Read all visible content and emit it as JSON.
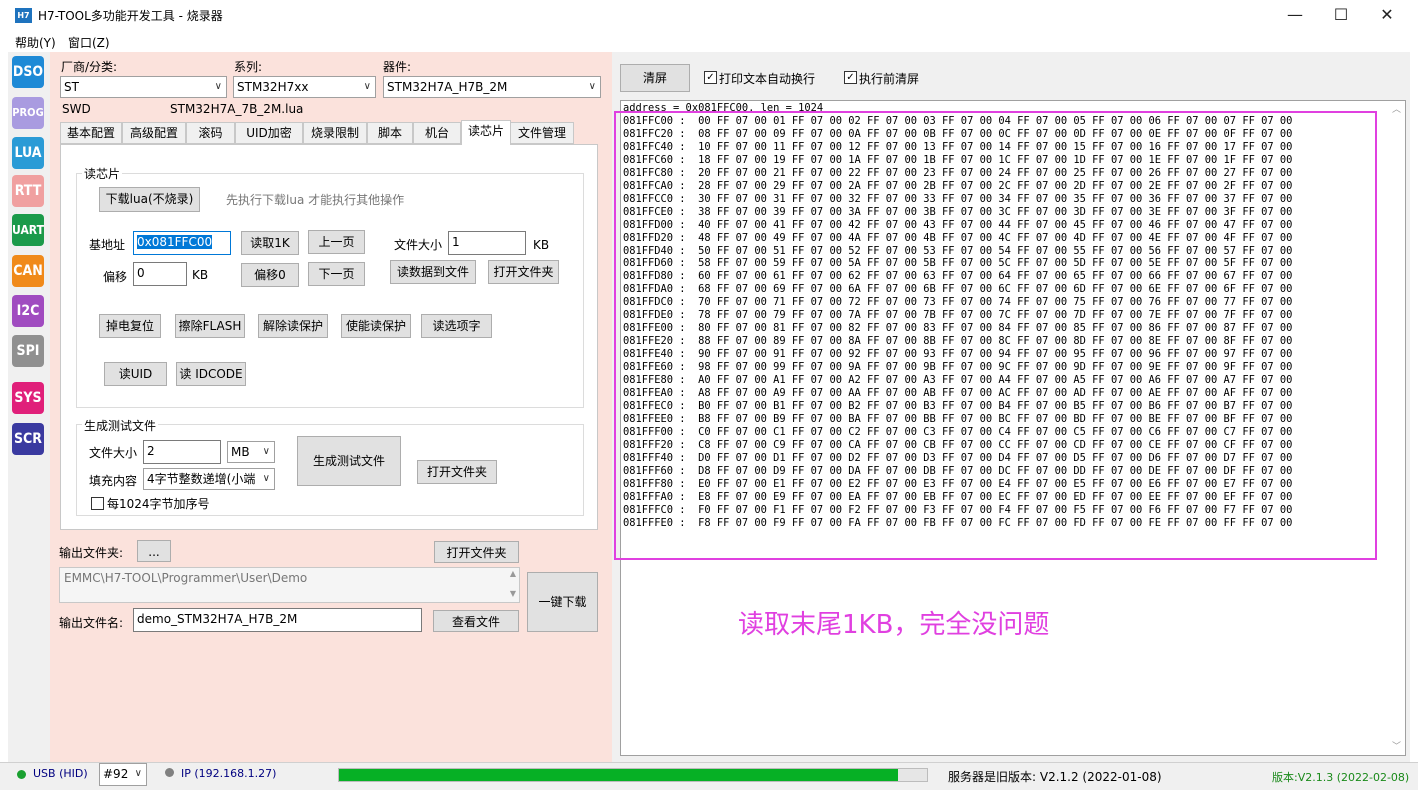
{
  "window": {
    "icon_text": "H7",
    "title": "H7-TOOL多功能开发工具 - 烧录器",
    "minimize": "—",
    "maximize": "☐",
    "close": "✕"
  },
  "menu": {
    "help": "帮助(Y)",
    "window": "窗口(Z)"
  },
  "sidebar": {
    "items": [
      {
        "label": "DSO",
        "color": "#1e8ad6"
      },
      {
        "label": "PROG",
        "color": "#a99be0"
      },
      {
        "label": "LUA",
        "color": "#2a9bd6"
      },
      {
        "label": "RTT",
        "color": "#f0a0a0"
      },
      {
        "label": "UART",
        "color": "#1a9a4a"
      },
      {
        "label": "CAN",
        "color": "#f08a1a"
      },
      {
        "label": "I2C",
        "color": "#a04cc0"
      },
      {
        "label": "SPI",
        "color": "#909090"
      },
      {
        "label": "SYS",
        "color": "#e0207a"
      },
      {
        "label": "SCR",
        "color": "#3a3aa0"
      }
    ]
  },
  "selectors": {
    "vendor_label": "厂商/分类:",
    "vendor_value": "ST",
    "series_label": "系列:",
    "series_value": "STM32H7xx",
    "device_label": "器件:",
    "device_value": "STM32H7A_H7B_2M",
    "interface": "SWD",
    "lua_file": "STM32H7A_7B_2M.lua"
  },
  "tabs": [
    "基本配置",
    "高级配置",
    "滚码",
    "UID加密",
    "烧录限制",
    "脚本",
    "机台",
    "读芯片",
    "文件管理"
  ],
  "active_tab": "读芯片",
  "read_chip": {
    "group_title": "读芯片",
    "download_lua_button": "下载lua(不烧录)",
    "hint": "先执行下载lua 才能执行其他操作",
    "base_addr_label": "基地址",
    "base_addr_value": "0x081FFC00",
    "read1k_button": "读取1K",
    "prev_page_button": "上一页",
    "file_size_label": "文件大小",
    "file_size_value": "1",
    "file_size_unit": "KB",
    "offset_label": "偏移",
    "offset_value": "0",
    "offset_unit": "KB",
    "offset0_button": "偏移0",
    "next_page_button": "下一页",
    "read_to_file_button": "读数据到文件",
    "open_folder_button": "打开文件夹",
    "power_reset_button": "掉电复位",
    "erase_flash_button": "擦除FLASH",
    "unprotect_button": "解除读保护",
    "protect_button": "使能读保护",
    "read_option_button": "读选项字",
    "read_uid_button": "读UID",
    "read_idcode_button": "读 IDCODE"
  },
  "gen_test": {
    "group_title": "生成测试文件",
    "size_label": "文件大小",
    "size_value": "2",
    "size_unit": "MB",
    "fill_label": "填充内容",
    "fill_value": "4字节整数递增(小端",
    "gen_button": "生成测试文件",
    "open_folder_button": "打开文件夹",
    "seq_checkbox_label": "每1024字节加序号"
  },
  "output": {
    "folder_label": "输出文件夹:",
    "browse_button": "...",
    "open_folder_button": "打开文件夹",
    "folder_path": "EMMC\\H7-TOOL\\Programmer\\User\\Demo",
    "one_key_button": "一键下载",
    "filename_label": "输出文件名:",
    "filename_value": "demo_STM32H7A_H7B_2M",
    "view_file_button": "查看文件"
  },
  "right": {
    "clear_button": "清屏",
    "auto_wrap_label": "打印文本自动换行",
    "clear_before_label": "执行前清屏",
    "auto_wrap_checked": "✓",
    "clear_before_checked": "✓",
    "header_line": "address = 0x081FFC00, len = 1024",
    "annotation": "读取末尾1KB，完全没问题"
  },
  "status": {
    "usb": "USB (HID)",
    "usb_color": "#1aa030",
    "device_num": "#92",
    "ip": "IP (192.168.1.27)",
    "ip_color": "#808080",
    "progress": 0.95,
    "server_version": "服务器是旧版本: V2.1.2 (2022-01-08)",
    "local_version": "版本:V2.1.3 (2022-02-08)"
  }
}
